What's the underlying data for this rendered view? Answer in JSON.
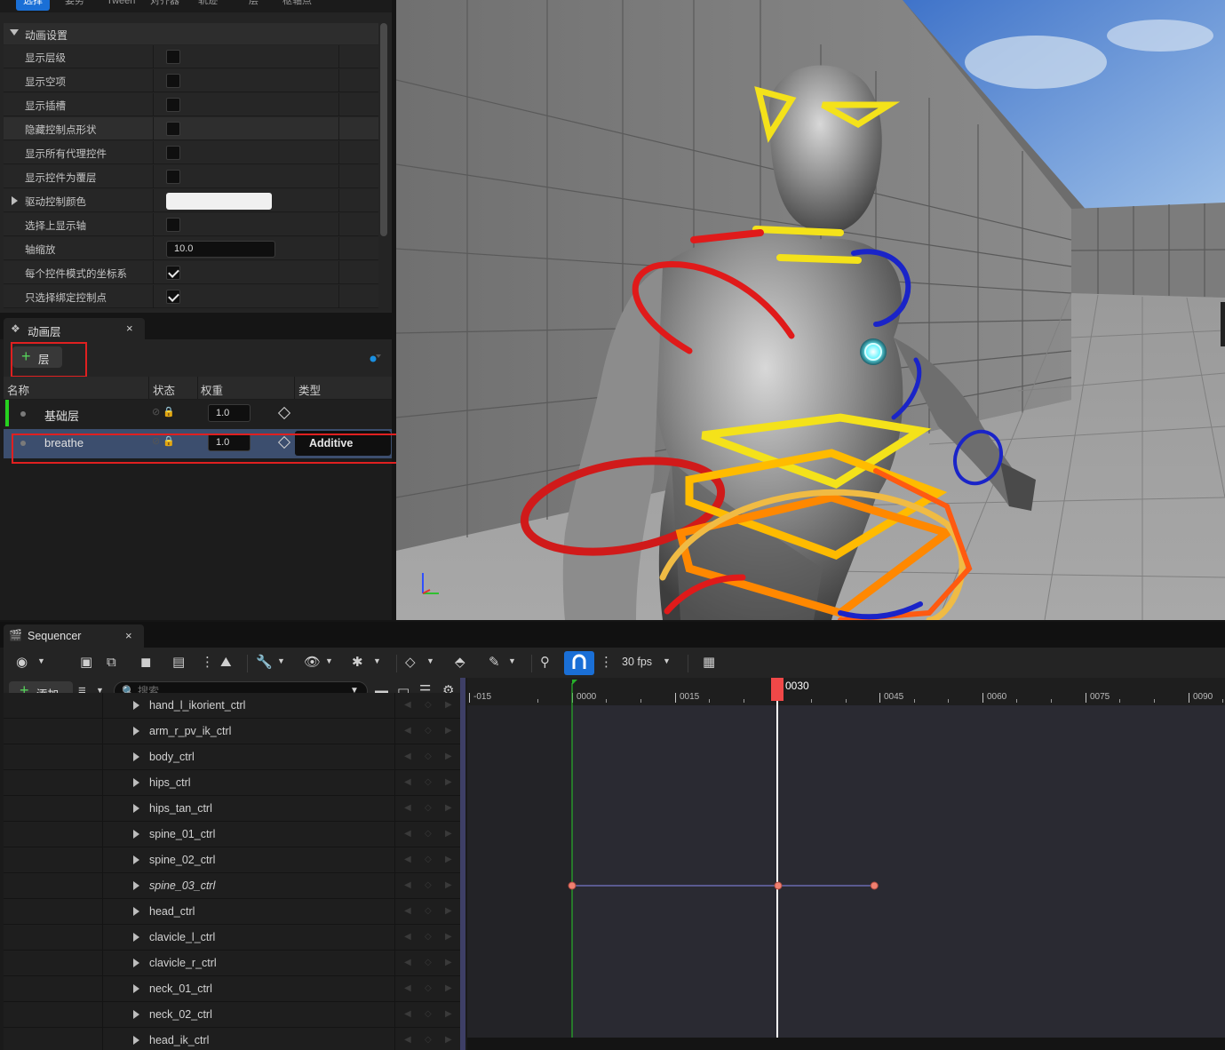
{
  "top_tabs": [
    "选择",
    "姿势",
    "Tween",
    "对齐器",
    "轨迹",
    "层",
    "枢轴点"
  ],
  "anim_settings": {
    "header": "动画设置",
    "rows": [
      {
        "label": "显示层级",
        "type": "checkbox",
        "checked": false
      },
      {
        "label": "显示空项",
        "type": "checkbox",
        "checked": false
      },
      {
        "label": "显示插槽",
        "type": "checkbox",
        "checked": false
      },
      {
        "label": "隐藏控制点形状",
        "type": "checkbox",
        "checked": false
      },
      {
        "label": "显示所有代理控件",
        "type": "checkbox",
        "checked": false
      },
      {
        "label": "显示控件为覆层",
        "type": "checkbox",
        "checked": false
      },
      {
        "label": "驱动控制颜色",
        "type": "color",
        "value": "#F0F0F0"
      },
      {
        "label": "选择上显示轴",
        "type": "checkbox",
        "checked": false
      },
      {
        "label": "轴缩放",
        "type": "number",
        "value": "10.0"
      },
      {
        "label": "每个控件模式的坐标系",
        "type": "checkbox",
        "checked": true
      },
      {
        "label": "只选择绑定控制点",
        "type": "checkbox",
        "checked": true
      }
    ]
  },
  "anim_layers": {
    "tab_label": "动画层",
    "tab_close": "×",
    "add_button_label": "层",
    "columns": {
      "name": "名称",
      "status": "状态",
      "weight": "权重",
      "type": "类型"
    },
    "layers": [
      {
        "name": "基础层",
        "weight": "1.0",
        "type": "",
        "active": true
      },
      {
        "name": "breathe",
        "weight": "1.0",
        "type": "Additive",
        "selected": true
      }
    ]
  },
  "sequencer": {
    "tab_label": "Sequencer",
    "tab_close": "×",
    "fps": "30 fps",
    "add_button_label": "添加",
    "search_placeholder": "搜索......",
    "tracks": [
      {
        "name": "hand_l_ikorient_ctrl",
        "italic": false
      },
      {
        "name": "arm_r_pv_ik_ctrl",
        "italic": false
      },
      {
        "name": "body_ctrl",
        "italic": false
      },
      {
        "name": "hips_ctrl",
        "italic": false
      },
      {
        "name": "hips_tan_ctrl",
        "italic": false
      },
      {
        "name": "spine_01_ctrl",
        "italic": false
      },
      {
        "name": "spine_02_ctrl",
        "italic": false
      },
      {
        "name": "spine_03_ctrl",
        "italic": true
      },
      {
        "name": "head_ctrl",
        "italic": false
      },
      {
        "name": "clavicle_l_ctrl",
        "italic": false
      },
      {
        "name": "clavicle_r_ctrl",
        "italic": false
      },
      {
        "name": "neck_01_ctrl",
        "italic": false
      },
      {
        "name": "neck_02_ctrl",
        "italic": false
      },
      {
        "name": "head_ik_ctrl",
        "italic": false
      }
    ],
    "ruler_labels": [
      "-015",
      "0000",
      "0015",
      "0030",
      "0045",
      "0060",
      "0075",
      "0090"
    ],
    "playhead_frame": "0030",
    "keyframe_frames": [
      0,
      30,
      44
    ],
    "keyframed_track": "spine_03_ctrl"
  },
  "colors": {
    "accent": "#1A6FD6",
    "active_layer": "#26D21F",
    "selection": "#3C4E6E",
    "playhead": "#F04848",
    "highlight_box": "#E02020",
    "key_color": "#F08070"
  }
}
